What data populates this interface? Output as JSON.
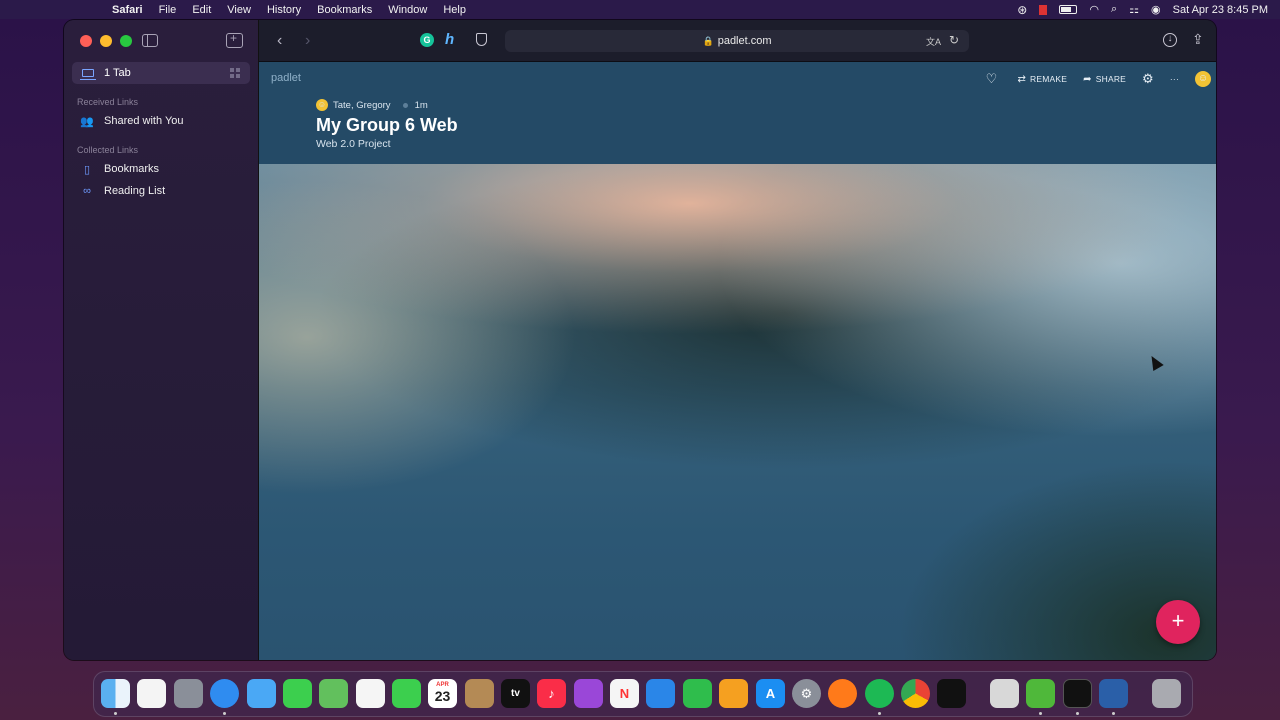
{
  "menubar": {
    "app_name": "Safari",
    "items": [
      "File",
      "Edit",
      "View",
      "History",
      "Bookmarks",
      "Window",
      "Help"
    ],
    "clock": "Sat Apr 23  8:45 PM"
  },
  "sidebar": {
    "tab_label": "1 Tab",
    "received_links_heading": "Received Links",
    "shared_with_you": "Shared with You",
    "collected_links_heading": "Collected Links",
    "bookmarks": "Bookmarks",
    "reading_list": "Reading List"
  },
  "toolbar": {
    "url": "padlet.com"
  },
  "padlet": {
    "logo": "padlet",
    "actions": {
      "remake": "REMAKE",
      "share": "SHARE"
    },
    "author": "Tate, Gregory",
    "time_ago": "1m",
    "title": "My Group 6 Web",
    "subtitle": "Web 2.0 Project",
    "fab_label": "+"
  },
  "dock": {
    "calendar_month": "APR",
    "calendar_day": "23",
    "tv_label": "tv"
  },
  "colors": {
    "header": "#244a66",
    "fab": "#e0245e",
    "menubar": "#2b1a4a"
  }
}
